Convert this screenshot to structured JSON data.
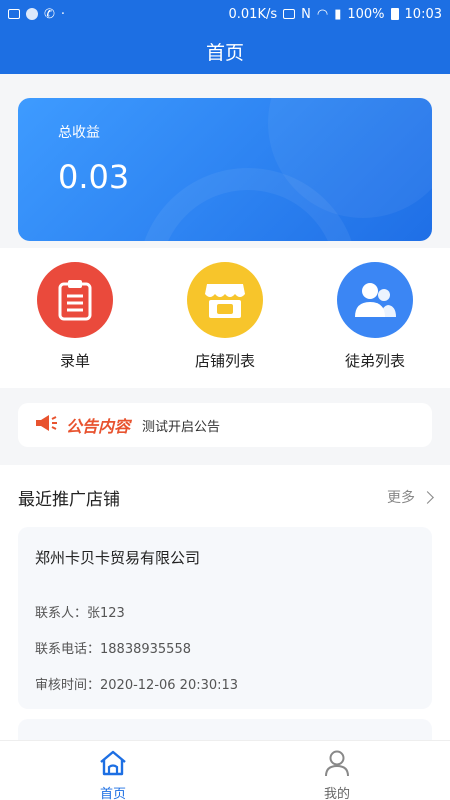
{
  "status_bar": {
    "net_speed": "0.01K/s",
    "battery": "100%",
    "time": "10:03"
  },
  "header": {
    "title": "首页"
  },
  "earnings": {
    "label": "总收益",
    "value": "0.03"
  },
  "quick_actions": [
    {
      "label": "录单",
      "icon": "clipboard-icon",
      "color": "#ea4a3c"
    },
    {
      "label": "店铺列表",
      "icon": "store-icon",
      "color": "#f7c52b"
    },
    {
      "label": "徒弟列表",
      "icon": "users-icon",
      "color": "#3b86f4"
    }
  ],
  "notice": {
    "tag": "公告内容",
    "text": "测试开启公告"
  },
  "recent_shops": {
    "title": "最近推广店铺",
    "more": "更多",
    "shops": [
      {
        "name": "郑州卡贝卡贸易有限公司",
        "contact": "联系人：张123",
        "phone": "联系电话：18838935558",
        "review_time": "审核时间：2020-12-06 20:30:13"
      }
    ]
  },
  "tabbar": {
    "tabs": [
      {
        "label": "首页",
        "active": true
      },
      {
        "label": "我的",
        "active": false
      }
    ]
  },
  "colors": {
    "primary": "#1d6fe3",
    "notice_tag": "#e8532f"
  }
}
